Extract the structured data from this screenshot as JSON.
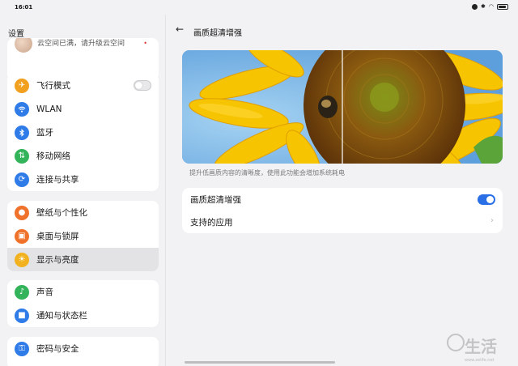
{
  "status_bar": {
    "time": "16:01"
  },
  "sidebar": {
    "title": "设置",
    "account": {
      "text": "云空间已满，请升级云空间"
    },
    "groups": [
      {
        "items": [
          {
            "label": "飞行模式",
            "icon": "airplane-icon",
            "color": "#f2a01f"
          },
          {
            "label": "WLAN",
            "icon": "wifi-icon",
            "color": "#2f7ce8"
          },
          {
            "label": "蓝牙",
            "icon": "bluetooth-icon",
            "color": "#2f7ce8"
          },
          {
            "label": "移动网络",
            "icon": "mobile-network-icon",
            "color": "#33b35a"
          },
          {
            "label": "连接与共享",
            "icon": "connection-share-icon",
            "color": "#2f7ce8"
          }
        ]
      },
      {
        "items": [
          {
            "label": "壁纸与个性化",
            "icon": "palette-icon",
            "color": "#f0722a"
          },
          {
            "label": "桌面与锁屏",
            "icon": "desktop-lock-icon",
            "color": "#f0722a"
          },
          {
            "label": "显示与亮度",
            "icon": "brightness-icon",
            "color": "#f2b21f"
          }
        ]
      },
      {
        "items": [
          {
            "label": "声音",
            "icon": "bell-icon",
            "color": "#33b35a"
          },
          {
            "label": "通知与状态栏",
            "icon": "notification-icon",
            "color": "#2f7ce8"
          }
        ]
      },
      {
        "items": [
          {
            "label": "密码与安全",
            "icon": "key-icon",
            "color": "#2f7ce8"
          }
        ]
      }
    ]
  },
  "main": {
    "title": "画质超清增强",
    "caption": "提升低画质内容的清晰度，使用此功能会增加系统耗电",
    "rows": [
      {
        "label": "画质超清增强",
        "enabled": true
      },
      {
        "label": "支持的应用"
      }
    ]
  },
  "watermark": {
    "text": "生活",
    "url": "www.zelife.net"
  },
  "colors": {
    "accent": "#2a6fe6",
    "background": "#f2f2f4",
    "card": "#ffffff"
  }
}
